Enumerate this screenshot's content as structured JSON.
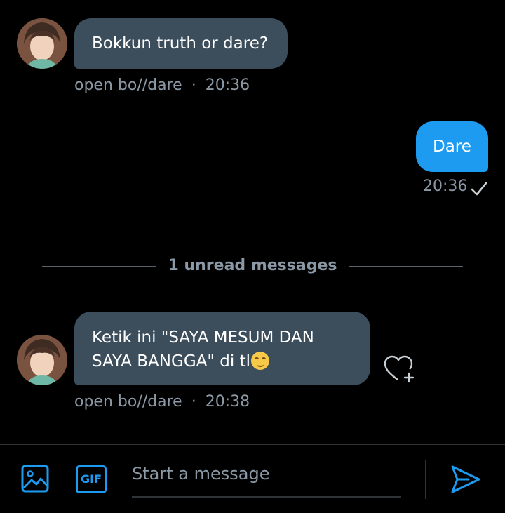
{
  "messages": [
    {
      "direction": "incoming",
      "text": "Bokkun truth or dare?",
      "sender": "open bo//dare",
      "time": "20:36"
    },
    {
      "direction": "outgoing",
      "text": "Dare",
      "time": "20:36",
      "status": "sent"
    },
    {
      "direction": "incoming",
      "text_line1": "Ketik ini \"SAYA MESUM DAN",
      "text_line2": "SAYA BANGGA\" di tl",
      "emoji": "smiling-face-with-blush-emoji",
      "sender": "open bo//dare",
      "time": "20:38"
    }
  ],
  "divider": {
    "label": "1 unread messages"
  },
  "composer": {
    "placeholder": "Start a message",
    "gif_label": "GIF"
  },
  "meta_separator": "·",
  "colors": {
    "accent": "#1d9bf0",
    "incoming_bubble": "#3c4d5c",
    "muted_text": "#8b98a5",
    "background": "#000000"
  },
  "icons": [
    "image-icon",
    "gif-icon",
    "send-icon",
    "react-heart-icon",
    "check-icon"
  ]
}
